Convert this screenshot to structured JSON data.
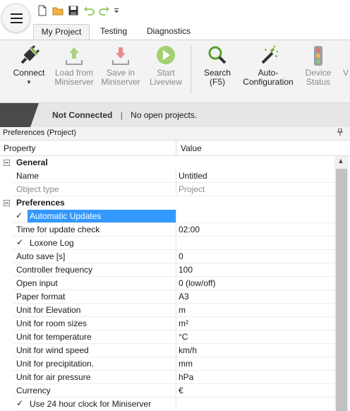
{
  "colors": {
    "accent": "#3399ff",
    "ribbon_bg": "#f3f3f3",
    "status_bg": "#e6e6e6",
    "icon_green": "#2e8b2e",
    "icon_gray": "#8bc34a"
  },
  "quick_access": {
    "icons": [
      "new-file-icon",
      "open-folder-icon",
      "save-icon",
      "undo-icon",
      "redo-icon",
      "customize-caret-icon"
    ]
  },
  "tabs": [
    {
      "label": "My Project",
      "active": true
    },
    {
      "label": "Testing"
    },
    {
      "label": "Diagnostics"
    }
  ],
  "ribbon": {
    "connect": "Connect",
    "load": "Load from\nMiniserver",
    "save": "Save in\nMiniserver",
    "liveview": "Start\nLiveview",
    "search": "Search\n(F5)",
    "autoconfig": "Auto-\nConfiguration",
    "device_status": "Device\nStatus",
    "cut_off": "V"
  },
  "status": {
    "connection": "Not Connected",
    "separator": "|",
    "projects": "No open projects."
  },
  "panel": {
    "title": "Preferences (Project)"
  },
  "grid": {
    "col_property": "Property",
    "col_value": "Value",
    "rows": [
      {
        "kind": "cat",
        "prop": "General"
      },
      {
        "prop": "Name",
        "val": "Untitled"
      },
      {
        "prop": "Object type",
        "val": "Project",
        "muted": true
      },
      {
        "kind": "cat",
        "prop": "Preferences"
      },
      {
        "prop": "Automatic Updates",
        "check": true,
        "selected": true
      },
      {
        "prop": "Time for update check",
        "val": "02:00"
      },
      {
        "prop": "Loxone Log",
        "check": true
      },
      {
        "prop": "Auto save [s]",
        "val": "0"
      },
      {
        "prop": "Controller frequency",
        "val": "100"
      },
      {
        "prop": "Open input",
        "val": "0 (low/off)"
      },
      {
        "prop": "Paper format",
        "val": "A3"
      },
      {
        "prop": "Unit for Elevation",
        "val": "m"
      },
      {
        "prop": "Unit for room sizes",
        "val": "m²"
      },
      {
        "prop": "Unit for temperature",
        "val": "°C"
      },
      {
        "prop": "Unit for wind speed",
        "val": "km/h"
      },
      {
        "prop": "Unit for precipitation.",
        "val": "mm"
      },
      {
        "prop": "Unit for air pressure",
        "val": "hPa"
      },
      {
        "prop": "Currency",
        "val": "€"
      },
      {
        "prop": "Use 24 hour clock for Miniserver",
        "check": true
      }
    ]
  },
  "checkmark": "✓"
}
